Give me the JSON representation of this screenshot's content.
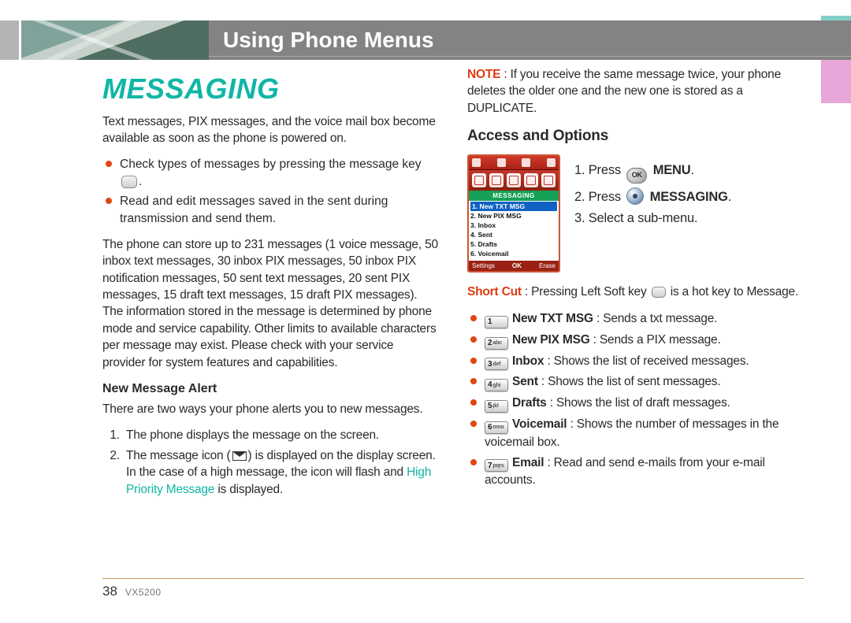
{
  "header": {
    "title": "Using Phone Menus"
  },
  "section": {
    "title": "MESSAGING"
  },
  "intro": "Text messages, PIX messages, and the voice mail box become available as soon as the phone is powered on.",
  "check_bullets": [
    "Check types of messages by pressing the message key",
    "Read and edit messages saved in the sent during transmission and send them."
  ],
  "storage_para": "The phone can store up to 231 messages (1 voice message, 50 inbox text messages, 30 inbox PIX messages, 50 inbox PIX notification messages, 50 sent text messages, 20 sent PIX messages, 15 draft text messages, 15 draft PIX messages). The information stored in the message is determined by phone mode and service capability. Other limits to available characters per message may exist. Please check with your service provider for system features and capabilities.",
  "alert_head": "New Message Alert",
  "alert_intro": "There are two ways your phone alerts you to new messages.",
  "alert_list": {
    "item1": "The phone displays the message on the screen.",
    "item2_a": "The message icon (",
    "item2_b": ") is displayed on the display screen. In the case of a high message, the icon will flash and ",
    "item2_c": "High Priority Message",
    "item2_d": " is displayed."
  },
  "note": {
    "label": "NOTE",
    "text": " : If you receive the same message twice, your phone deletes the older one and the new one is stored as a DUPLICATE."
  },
  "access_head": "Access and Options",
  "steps": {
    "s1a": "1.  Press ",
    "s1b": "MENU",
    "s1c": ".",
    "s2a": "2.  Press ",
    "s2b": "MESSAGING",
    "s2c": ".",
    "s3": "3.  Select a sub-menu."
  },
  "shortcut": {
    "label": "Short Cut",
    "a": " : Pressing Left Soft key ",
    "b": " is a hot key to Message."
  },
  "phone": {
    "title": "MESSAGING",
    "items": [
      "1. New TXT MSG",
      "2. New PIX MSG",
      "3. Inbox",
      "4. Sent",
      "5. Drafts",
      "6. Voicemail"
    ],
    "soft": [
      "Settings",
      "OK",
      "Erase"
    ]
  },
  "submenus": [
    {
      "key_n": "1",
      "key_s": "",
      "name": "New TXT MSG",
      "desc": " : Sends a txt message."
    },
    {
      "key_n": "2",
      "key_s": "abc",
      "name": "New PIX MSG",
      "desc": " : Sends a PIX message."
    },
    {
      "key_n": "3",
      "key_s": "def",
      "name": "Inbox",
      "desc": " : Shows the list of received messages."
    },
    {
      "key_n": "4",
      "key_s": "ghi",
      "name": "Sent",
      "desc": " : Shows the list of sent messages."
    },
    {
      "key_n": "5",
      "key_s": "jkl",
      "name": "Drafts",
      "desc": " : Shows the list of draft messages."
    },
    {
      "key_n": "6",
      "key_s": "mno",
      "name": "Voicemail",
      "desc": " : Shows the number of messages in the voicemail box."
    },
    {
      "key_n": "7",
      "key_s": "pqrs",
      "name": "Email",
      "desc": " : Read and send e-mails from your e-mail accounts."
    }
  ],
  "footer": {
    "page": "38",
    "model": "VX5200"
  }
}
